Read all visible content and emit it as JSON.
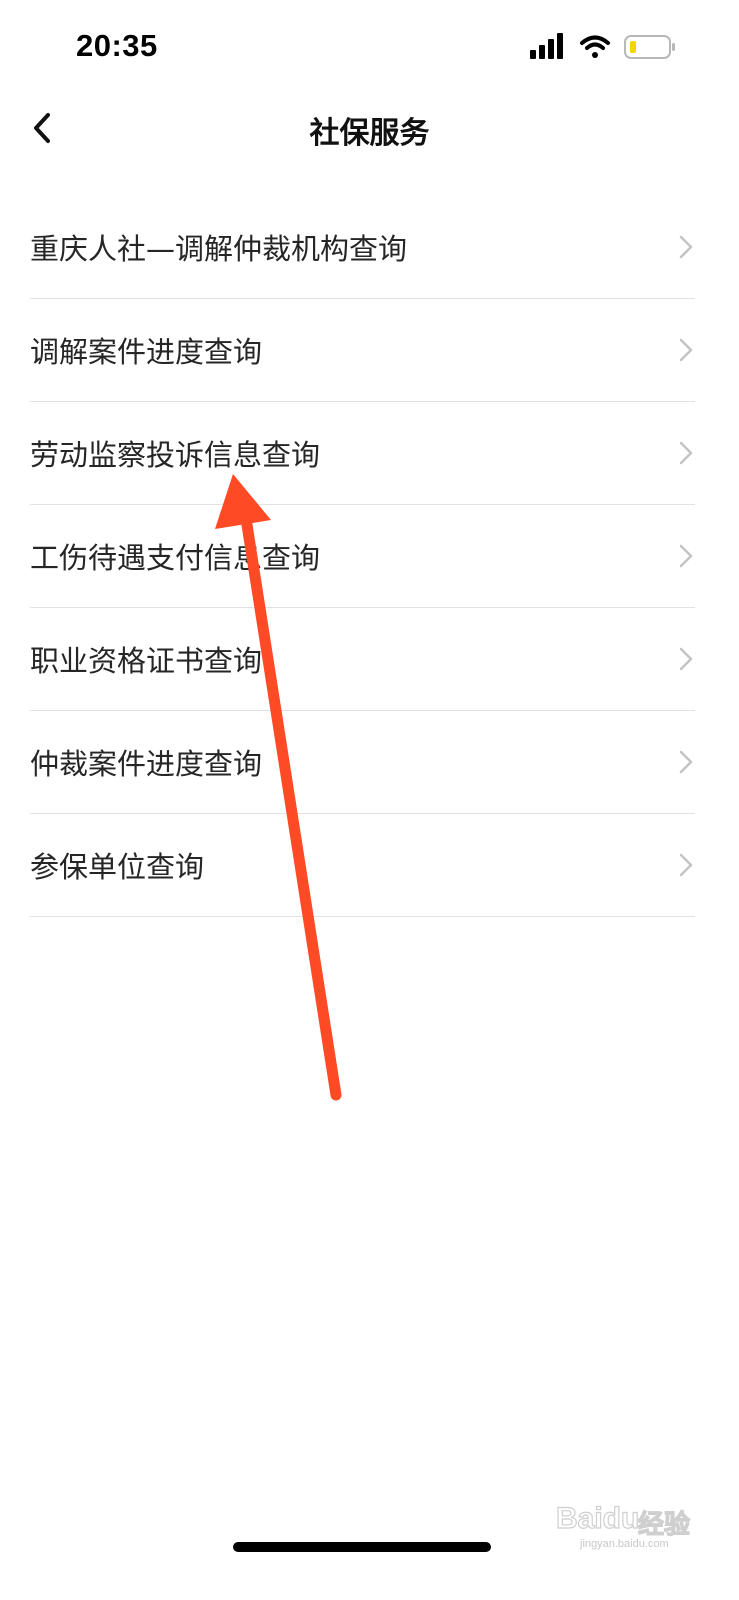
{
  "status_bar": {
    "time": "20:35",
    "icons": [
      "signal-icon",
      "wifi-icon",
      "battery-icon"
    ],
    "battery_color": "#f5d400"
  },
  "nav": {
    "back_icon": "chevron-left-icon",
    "title": "社保服务"
  },
  "menu": {
    "items": [
      {
        "label": "重庆人社—调解仲裁机构查询"
      },
      {
        "label": "调解案件进度查询"
      },
      {
        "label": "劳动监察投诉信息查询"
      },
      {
        "label": "工伤待遇支付信息查询"
      },
      {
        "label": "职业资格证书查询"
      },
      {
        "label": "仲裁案件进度查询"
      },
      {
        "label": "参保单位查询"
      }
    ],
    "chevron_icon": "chevron-right-icon"
  },
  "annotation": {
    "arrow_color": "#ff4a26",
    "points_to": "劳动监察投诉信息查询"
  },
  "watermark": {
    "logo": "Baidu",
    "text": "经验",
    "url": "jingyan.baidu.com"
  },
  "colors": {
    "background": "#ffffff",
    "divider": "#e2e2e2",
    "chevron": "#c4c4c4",
    "text": "#262626"
  }
}
